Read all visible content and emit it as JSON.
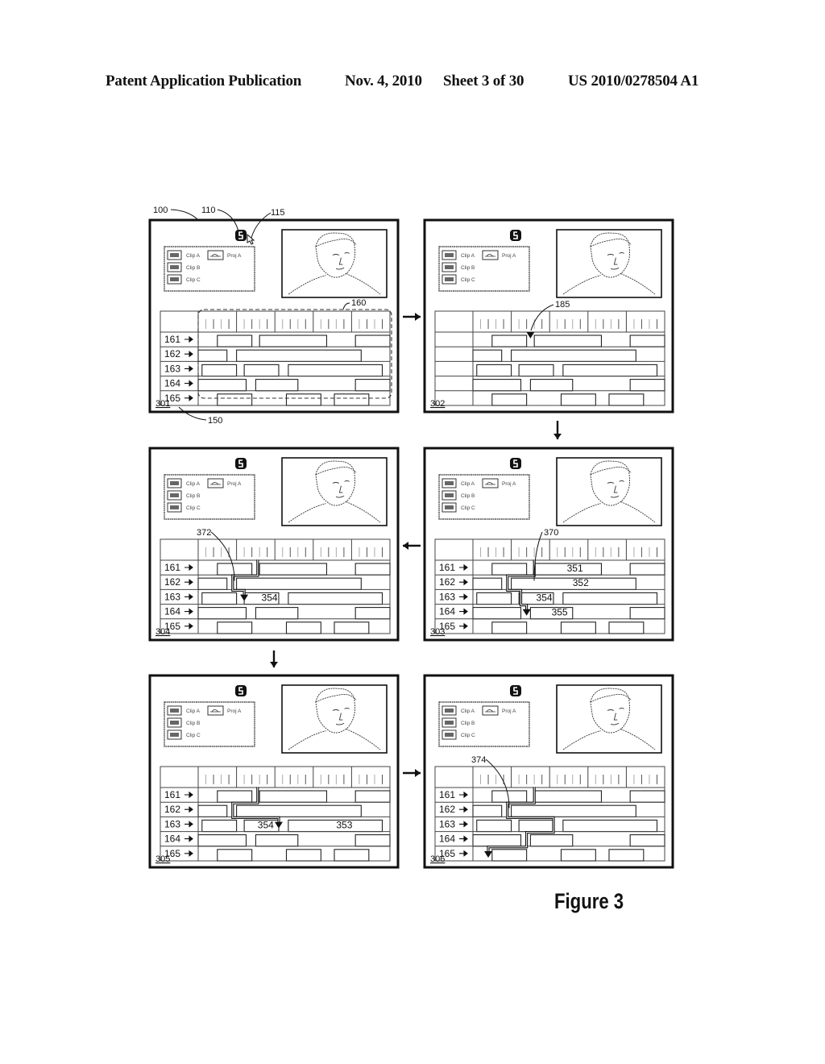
{
  "header": {
    "publication": "Patent Application Publication",
    "date": "Nov. 4, 2010",
    "sheet": "Sheet 3 of 30",
    "number": "US 2010/0278504 A1"
  },
  "figure_label": "Figure 3",
  "media_library": {
    "clips": [
      "Clip A",
      "Clip B",
      "Clip C"
    ],
    "projects": [
      "Proj A"
    ]
  },
  "track_labels": [
    "161",
    "162",
    "163",
    "164",
    "165"
  ],
  "tracks": [
    [
      [
        0.1,
        0.28
      ],
      [
        0.32,
        0.67
      ],
      [
        0.82,
        1.0
      ]
    ],
    [
      [
        0.0,
        0.15
      ],
      [
        0.2,
        0.85
      ]
    ],
    [
      [
        0.02,
        0.2
      ],
      [
        0.24,
        0.42
      ],
      [
        0.47,
        0.96
      ]
    ],
    [
      [
        0.0,
        0.25
      ],
      [
        0.3,
        0.52
      ],
      [
        0.82,
        1.0
      ]
    ],
    [
      [
        0.1,
        0.28
      ],
      [
        0.46,
        0.64
      ],
      [
        0.71,
        0.89
      ]
    ]
  ],
  "panels": [
    {
      "id": "301",
      "show_track_labels": true,
      "refs": [
        "100",
        "110",
        "115",
        "160",
        "150"
      ],
      "clip_labels": [],
      "path": null,
      "path_ref": null,
      "playhead": null
    },
    {
      "id": "302",
      "show_track_labels": false,
      "refs": [
        "185"
      ],
      "clip_labels": [],
      "path": null,
      "path_ref": null,
      "playhead": {
        "track": 0,
        "x": 0.3
      }
    },
    {
      "id": "303",
      "show_track_labels": true,
      "refs": [
        "370"
      ],
      "clip_labels": [
        {
          "track": 0,
          "text": "351",
          "x": 0.49
        },
        {
          "track": 1,
          "text": "352",
          "x": 0.52
        },
        {
          "track": 2,
          "text": "354",
          "x": 0.33
        },
        {
          "track": 3,
          "text": "355",
          "x": 0.41
        }
      ],
      "path": [
        [
          0.32,
          -0.1
        ],
        [
          0.32,
          1.0
        ],
        [
          0.18,
          1.0
        ],
        [
          0.18,
          2.0
        ],
        [
          0.25,
          2.0
        ],
        [
          0.25,
          3.0
        ],
        [
          0.28,
          3.0
        ],
        [
          0.28,
          3.3
        ]
      ],
      "path_ref": "370",
      "playhead": {
        "track": 3,
        "x": 0.28
      }
    },
    {
      "id": "304",
      "show_track_labels": true,
      "refs": [
        "372"
      ],
      "clip_labels": [
        {
          "track": 2,
          "text": "354",
          "x": 0.33
        }
      ],
      "path": [
        [
          0.31,
          -0.1
        ],
        [
          0.31,
          1.0
        ],
        [
          0.18,
          1.0
        ],
        [
          0.18,
          2.0
        ],
        [
          0.24,
          2.0
        ],
        [
          0.24,
          2.3
        ]
      ],
      "path_ref": "372",
      "playhead": {
        "track": 2,
        "x": 0.24
      }
    },
    {
      "id": "305",
      "show_track_labels": true,
      "refs": [],
      "clip_labels": [
        {
          "track": 2,
          "text": "354",
          "x": 0.31
        },
        {
          "track": 2,
          "text": "353",
          "x": 0.72
        }
      ],
      "path": [
        [
          0.31,
          -0.1
        ],
        [
          0.31,
          1.0
        ],
        [
          0.18,
          1.0
        ],
        [
          0.18,
          2.0
        ],
        [
          0.42,
          2.0
        ],
        [
          0.42,
          2.4
        ]
      ],
      "path_ref": null,
      "playhead": {
        "track": 2,
        "x": 0.42
      }
    },
    {
      "id": "306",
      "show_track_labels": true,
      "refs": [
        "374"
      ],
      "clip_labels": [],
      "path": [
        [
          0.32,
          -0.1
        ],
        [
          0.32,
          1.0
        ],
        [
          0.18,
          1.0
        ],
        [
          0.18,
          2.0
        ],
        [
          0.42,
          2.0
        ],
        [
          0.42,
          3.0
        ],
        [
          0.28,
          3.0
        ],
        [
          0.28,
          4.0
        ],
        [
          0.08,
          4.0
        ],
        [
          0.08,
          4.6
        ]
      ],
      "path_ref": "374",
      "playhead": {
        "track": 4,
        "x": 0.08
      }
    }
  ],
  "flow_arrows": [
    "301→302",
    "302→303",
    "303→304",
    "304→305",
    "305→306"
  ]
}
